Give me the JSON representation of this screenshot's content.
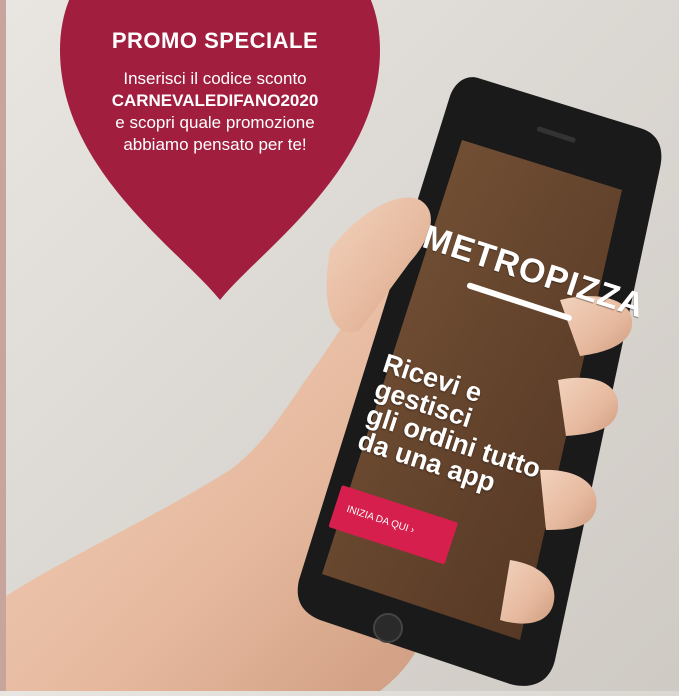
{
  "promo": {
    "title": "PROMO SPECIALE",
    "line1": "Inserisci il codice sconto",
    "code": "CARNEVALEDIFANO2020",
    "line3": "e scopri quale promozione",
    "line4": "abbiamo pensato per te!"
  },
  "phone": {
    "logo": "METROPIZZA",
    "logo_sub": "",
    "headline_1": "Ricevi e gestisci",
    "headline_2": "gli ordini tutto",
    "headline_3": "da una app",
    "cta_label": "INIZIA DA QUI  ›"
  },
  "colors": {
    "heart": "#a11e3e",
    "cta": "#d71f4d",
    "screen": "#6e4a2e"
  }
}
